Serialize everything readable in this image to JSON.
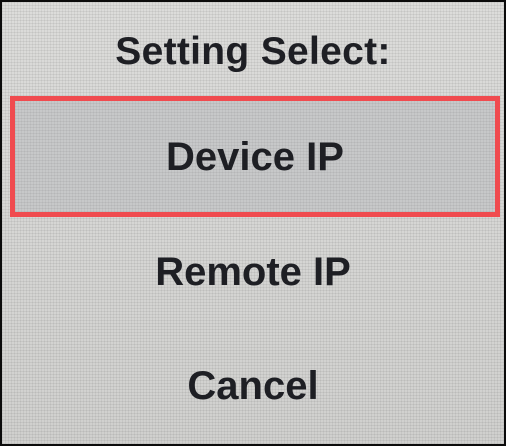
{
  "menu": {
    "title": "Setting Select:",
    "items": [
      {
        "label": "Device IP",
        "selected": true
      },
      {
        "label": "Remote IP",
        "selected": false
      },
      {
        "label": "Cancel",
        "selected": false
      }
    ],
    "highlight_color": "#f04b4f",
    "text_color": "#1e1f24",
    "background_color": "#d4d4d2"
  }
}
